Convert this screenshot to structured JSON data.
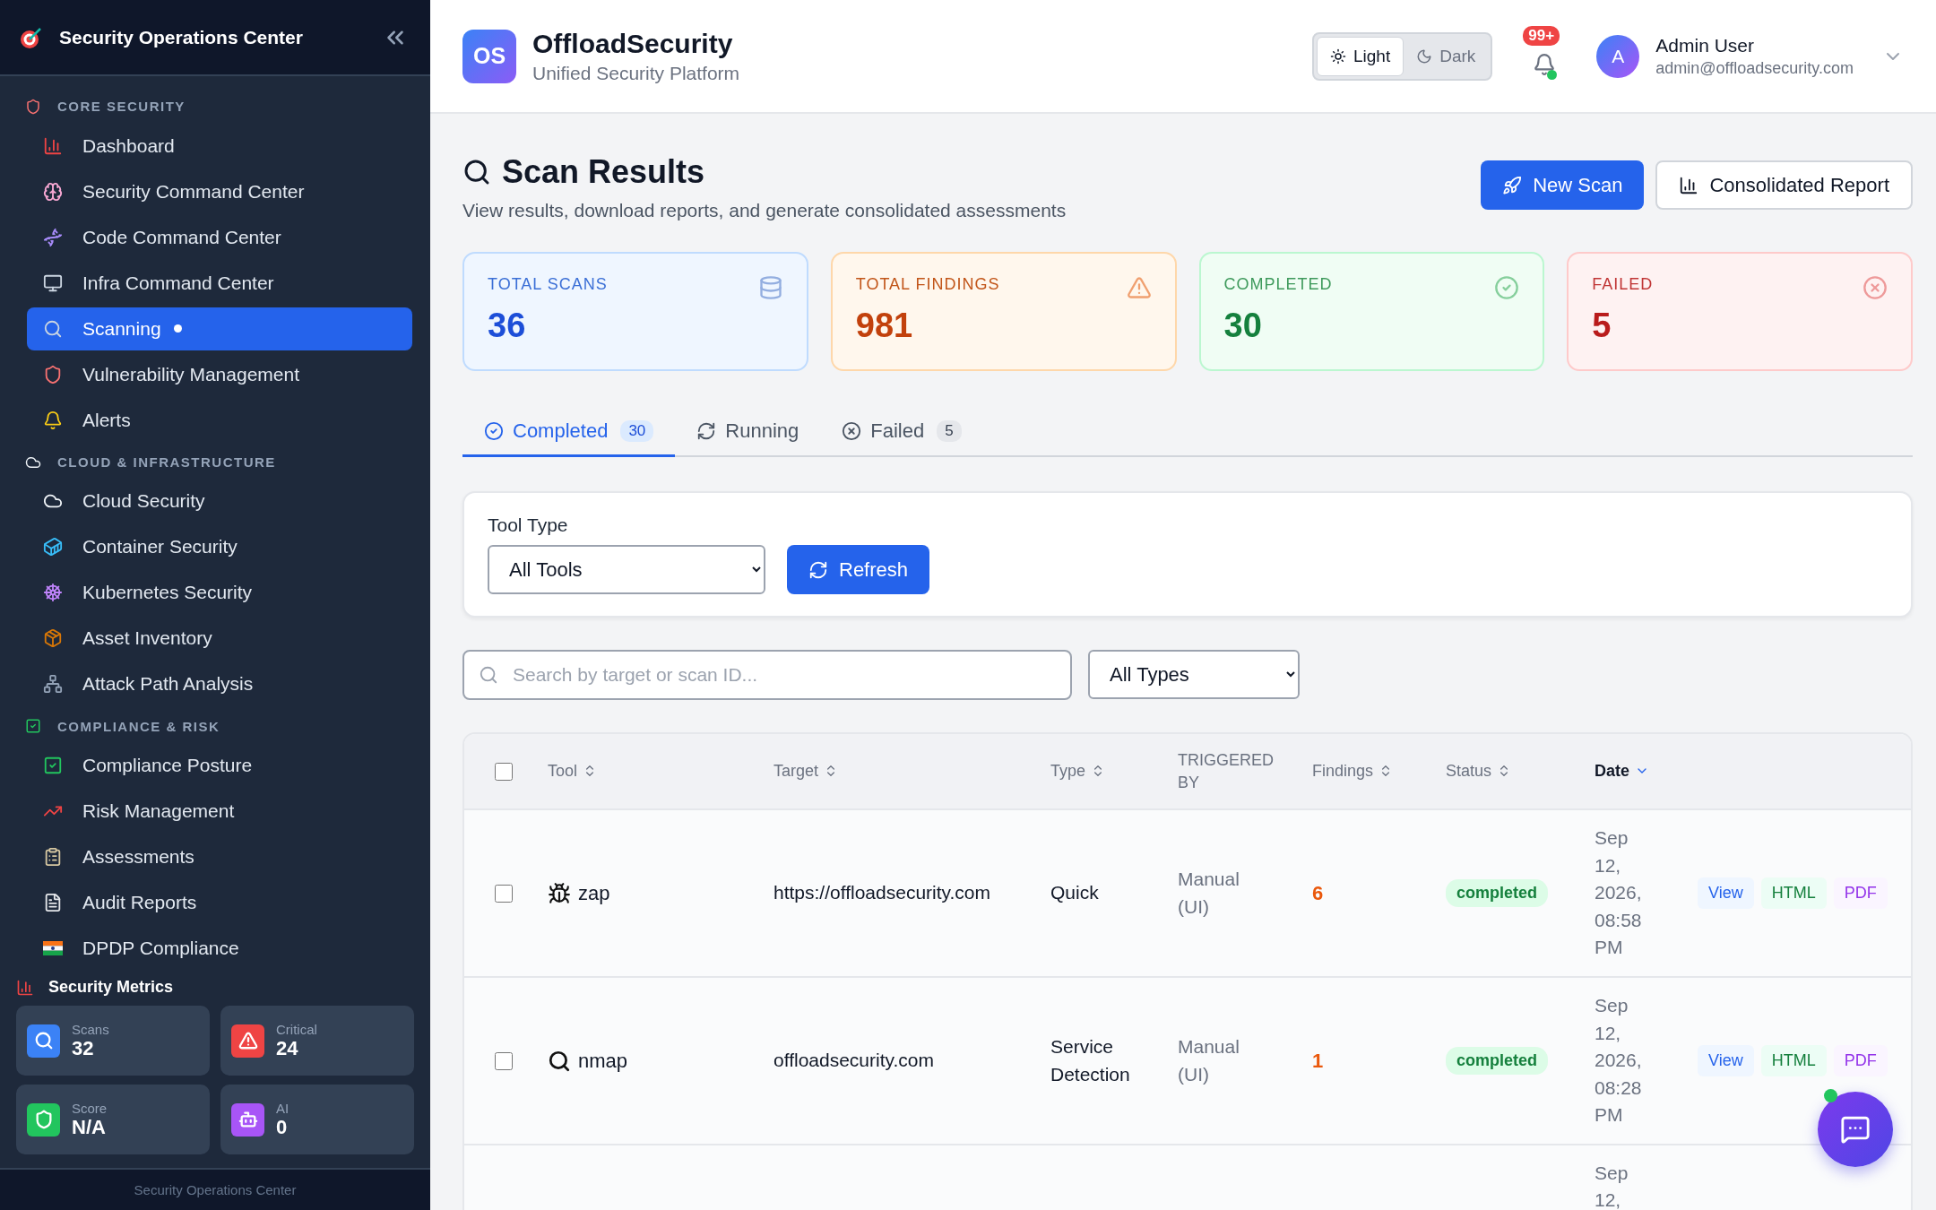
{
  "sidebar": {
    "title": "Security Operations Center",
    "sections": [
      {
        "label": "CORE SECURITY",
        "items": [
          {
            "label": "Dashboard",
            "selected": false,
            "indicator": false
          },
          {
            "label": "Security Command Center",
            "selected": false,
            "indicator": false
          },
          {
            "label": "Code Command Center",
            "selected": false,
            "indicator": false
          },
          {
            "label": "Infra Command Center",
            "selected": false,
            "indicator": false
          },
          {
            "label": "Scanning",
            "selected": true,
            "indicator": true
          },
          {
            "label": "Vulnerability Management",
            "selected": false,
            "indicator": false
          },
          {
            "label": "Alerts",
            "selected": false,
            "indicator": false
          }
        ]
      },
      {
        "label": "CLOUD & INFRASTRUCTURE",
        "items": [
          {
            "label": "Cloud Security",
            "selected": false,
            "indicator": false
          },
          {
            "label": "Container Security",
            "selected": false,
            "indicator": false
          },
          {
            "label": "Kubernetes Security",
            "selected": false,
            "indicator": false
          },
          {
            "label": "Asset Inventory",
            "selected": false,
            "indicator": false
          },
          {
            "label": "Attack Path Analysis",
            "selected": false,
            "indicator": false
          }
        ]
      },
      {
        "label": "COMPLIANCE & RISK",
        "items": [
          {
            "label": "Compliance Posture",
            "selected": false,
            "indicator": false
          },
          {
            "label": "Risk Management",
            "selected": false,
            "indicator": false
          },
          {
            "label": "Assessments",
            "selected": false,
            "indicator": false
          },
          {
            "label": "Audit Reports",
            "selected": false,
            "indicator": false
          },
          {
            "label": "DPDP Compliance",
            "selected": false,
            "indicator": false
          }
        ]
      }
    ],
    "metrics": {
      "title": "Security Metrics",
      "cards": [
        {
          "label": "Scans",
          "value": "32",
          "color": "#3b82f6"
        },
        {
          "label": "Critical",
          "value": "24",
          "color": "#ef4444"
        },
        {
          "label": "Score",
          "value": "N/A",
          "color": "#22c55e"
        },
        {
          "label": "AI",
          "value": "0",
          "color": "#a855f7"
        }
      ]
    },
    "footer": "Security Operations Center"
  },
  "header": {
    "logo": "OS",
    "brand": "OffloadSecurity",
    "tagline": "Unified Security Platform",
    "theme": [
      {
        "label": "Light",
        "selected": true
      },
      {
        "label": "Dark",
        "selected": false
      }
    ],
    "notifications": "99+",
    "avatar": "A",
    "user_name": "Admin User",
    "user_email": "admin@offloadsecurity.com"
  },
  "page": {
    "title": "Scan Results",
    "subtitle": "View results, download reports, and generate consolidated assessments",
    "buttons": [
      {
        "label": "New Scan",
        "kind": "primary"
      },
      {
        "label": "Consolidated Report",
        "kind": "secondary"
      }
    ],
    "stats": [
      {
        "label": "TOTAL SCANS",
        "value": "36",
        "kind": "info"
      },
      {
        "label": "TOTAL FINDINGS",
        "value": "981",
        "kind": "warning"
      },
      {
        "label": "COMPLETED",
        "value": "30",
        "kind": "success"
      },
      {
        "label": "FAILED",
        "value": "5",
        "kind": "danger"
      }
    ],
    "tabs": [
      {
        "label": "Completed",
        "count": "30",
        "selected": true
      },
      {
        "label": "Running",
        "selected": false
      },
      {
        "label": "Failed",
        "count": "5",
        "selected": false
      }
    ],
    "filter": {
      "label": "Tool Type",
      "value": "All Tools",
      "button": "Refresh"
    },
    "search": {
      "placeholder": "Search by target or scan ID...",
      "type_filter": "All Types"
    },
    "table": {
      "select_all": false,
      "columns": [
        {
          "label": "Tool",
          "sortable": true,
          "selected": false
        },
        {
          "label": "Target",
          "sortable": true,
          "selected": false
        },
        {
          "label": "Type",
          "sortable": true,
          "selected": false
        },
        {
          "label": "TRIGGERED BY",
          "sortable": false,
          "selected": false
        },
        {
          "label": "Findings",
          "sortable": true,
          "selected": false
        },
        {
          "label": "Status",
          "sortable": true,
          "selected": false
        },
        {
          "label": "Date",
          "sortable": true,
          "selected": true
        }
      ],
      "rows": [
        {
          "checked": false,
          "tool": "zap",
          "target": "https://offloadsecurity.com",
          "type": "Quick",
          "triggered_by": "Manual (UI)",
          "findings": "6",
          "status": "completed",
          "date": "Sep 12, 2026, 08:58 PM",
          "actions": [
            "View",
            "HTML",
            "PDF"
          ]
        },
        {
          "checked": false,
          "tool": "nmap",
          "target": "offloadsecurity.com",
          "type": "Service Detection",
          "triggered_by": "Manual (UI)",
          "findings": "1",
          "status": "completed",
          "date": "Sep 12, 2026, 08:28 PM",
          "actions": [
            "View",
            "HTML",
            "PDF"
          ]
        },
        {
          "date": "Sep 12,"
        }
      ]
    }
  }
}
